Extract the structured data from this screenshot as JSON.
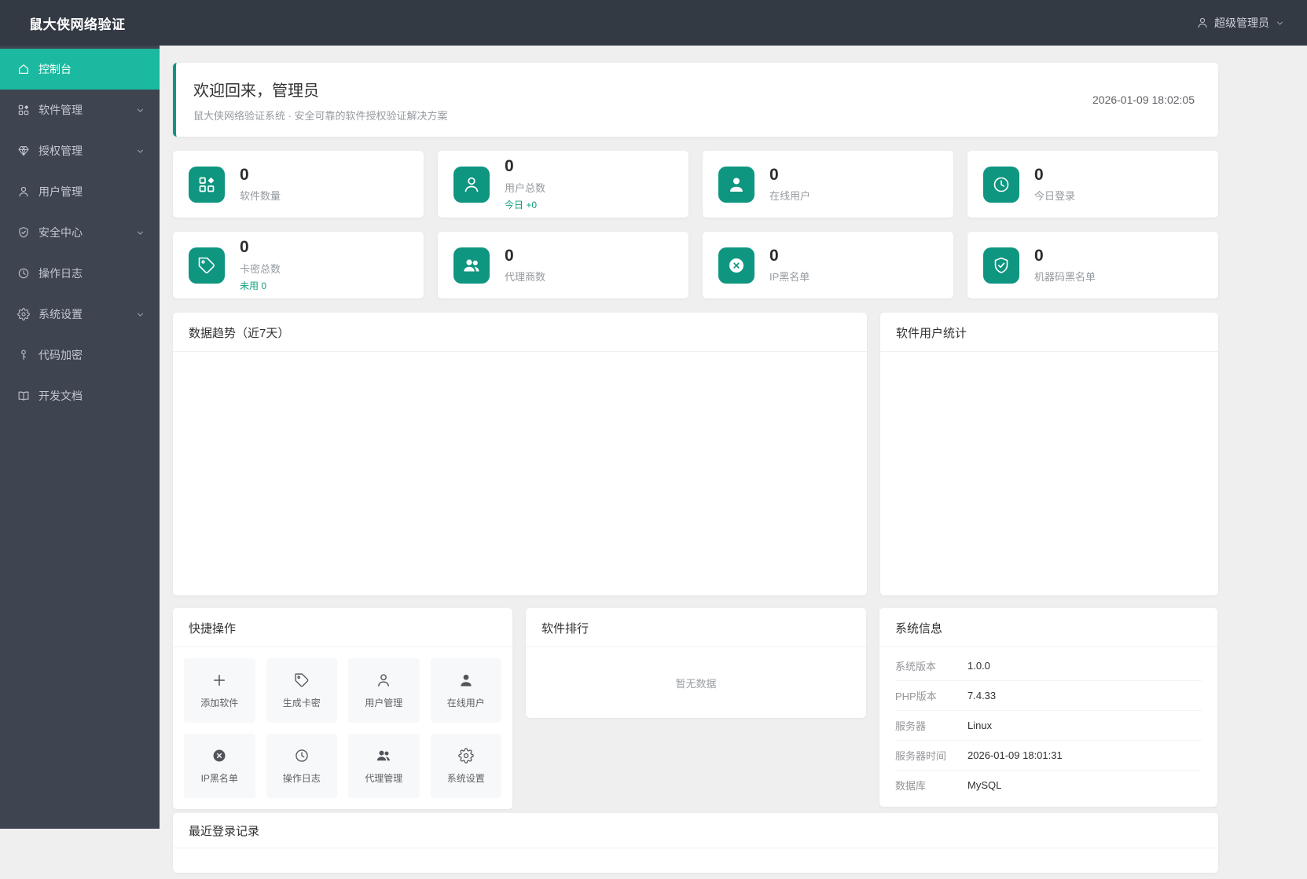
{
  "app": {
    "title": "鼠大侠网络验证"
  },
  "header": {
    "user": {
      "name": "超级管理员",
      "icon": "user-icon",
      "chevron_icon": "chevron-down-icon"
    }
  },
  "sidebar": {
    "items": [
      {
        "label": "控制台",
        "icon": "home-icon",
        "active": true
      },
      {
        "label": "软件管理",
        "icon": "apps-icon",
        "expandable": true
      },
      {
        "label": "授权管理",
        "icon": "gem-icon",
        "expandable": true
      },
      {
        "label": "用户管理",
        "icon": "user-icon"
      },
      {
        "label": "安全中心",
        "icon": "shield-check-icon",
        "expandable": true
      },
      {
        "label": "操作日志",
        "icon": "clock-icon"
      },
      {
        "label": "系统设置",
        "icon": "gear-icon",
        "expandable": true
      },
      {
        "label": "代码加密",
        "icon": "key-icon"
      },
      {
        "label": "开发文档",
        "icon": "book-icon"
      }
    ]
  },
  "welcome": {
    "title": "欢迎回来，管理员",
    "subtitle": "鼠大侠网络验证系统 · 安全可靠的软件授权验证解决方案",
    "timestamp": "2026-01-09 18:02:05"
  },
  "stats": [
    {
      "value": "0",
      "label": "软件数量",
      "icon": "apps-icon"
    },
    {
      "value": "0",
      "label": "用户总数",
      "sub": "今日 +0",
      "icon": "user-icon"
    },
    {
      "value": "0",
      "label": "在线用户",
      "icon": "user-filled-icon"
    },
    {
      "value": "0",
      "label": "今日登录",
      "icon": "clock-icon"
    },
    {
      "value": "0",
      "label": "卡密总数",
      "sub": "未用 0",
      "icon": "tag-icon"
    },
    {
      "value": "0",
      "label": "代理商数",
      "icon": "users-icon"
    },
    {
      "value": "0",
      "label": "IP黑名单",
      "icon": "x-circle-icon"
    },
    {
      "value": "0",
      "label": "机器码黑名单",
      "icon": "shield-check-icon"
    }
  ],
  "trend_panel": {
    "title": "数据趋势（近7天）"
  },
  "software_user_panel": {
    "title": "软件用户统计"
  },
  "quick_panel": {
    "title": "快捷操作",
    "actions": [
      {
        "label": "添加软件",
        "icon": "plus-icon"
      },
      {
        "label": "生成卡密",
        "icon": "tag-icon"
      },
      {
        "label": "用户管理",
        "icon": "user-icon"
      },
      {
        "label": "在线用户",
        "icon": "user-filled-icon"
      },
      {
        "label": "IP黑名单",
        "icon": "x-circle-icon"
      },
      {
        "label": "操作日志",
        "icon": "clock-icon"
      },
      {
        "label": "代理管理",
        "icon": "users-icon"
      },
      {
        "label": "系统设置",
        "icon": "gear-icon"
      }
    ]
  },
  "ranking_panel": {
    "title": "软件排行",
    "empty_text": "暂无数据"
  },
  "system_panel": {
    "title": "系统信息",
    "rows": [
      {
        "label": "系统版本",
        "value": "1.0.0"
      },
      {
        "label": "PHP版本",
        "value": "7.4.33"
      },
      {
        "label": "服务器",
        "value": "Linux"
      },
      {
        "label": "服务器时间",
        "value": "2026-01-09 18:01:31"
      },
      {
        "label": "数据库",
        "value": "MySQL"
      }
    ]
  },
  "recent_panel": {
    "title": "最近登录记录"
  },
  "colors": {
    "accent": "#0e9680",
    "active": "#1bb9a0",
    "success": "#12a07d",
    "header-bg": "#343a44",
    "sidebar-bg": "#3e4450",
    "page-bg": "#efefef",
    "text": "#303133",
    "muted": "#909399"
  }
}
